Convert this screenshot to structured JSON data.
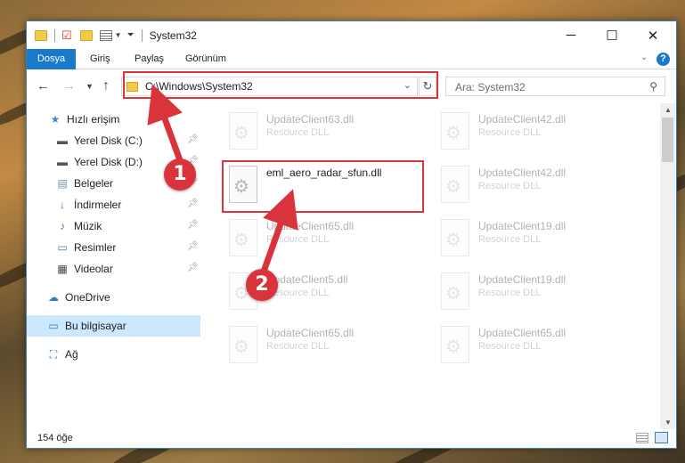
{
  "window": {
    "title": "System32"
  },
  "ribbon": {
    "tabs": [
      "Dosya",
      "Giriş",
      "Paylaş",
      "Görünüm"
    ]
  },
  "address": {
    "path": "C:\\Windows\\System32"
  },
  "search": {
    "placeholder": "Ara: System32"
  },
  "sidebar": {
    "items": [
      {
        "label": "Hızlı erişim",
        "icon": "star-icon"
      },
      {
        "label": "Yerel Disk (C:)",
        "icon": "drive-icon",
        "pinned": true
      },
      {
        "label": "Yerel Disk (D:)",
        "icon": "drive-icon",
        "pinned": true
      },
      {
        "label": "Belgeler",
        "icon": "document-icon",
        "pinned": true
      },
      {
        "label": "İndirmeler",
        "icon": "download-icon",
        "pinned": true
      },
      {
        "label": "Müzik",
        "icon": "music-icon",
        "pinned": true
      },
      {
        "label": "Resimler",
        "icon": "pictures-icon",
        "pinned": true
      },
      {
        "label": "Videolar",
        "icon": "video-icon",
        "pinned": true
      },
      {
        "label": "OneDrive",
        "icon": "cloud-icon"
      },
      {
        "label": "Bu bilgisayar",
        "icon": "computer-icon",
        "selected": true
      },
      {
        "label": "Ağ",
        "icon": "network-icon"
      }
    ]
  },
  "files": {
    "left": [
      {
        "name": "UpdateClient63.dll",
        "type": "Resource DLL"
      },
      {
        "name": "eml_aero_radar_sfun.dll",
        "type": ""
      },
      {
        "name": "UpdateClient65.dll",
        "type": "Resource DLL"
      },
      {
        "name": "UpdateClient5.dll",
        "type": "Resource DLL"
      },
      {
        "name": "UpdateClient65.dll",
        "type": "Resource DLL"
      }
    ],
    "right": [
      {
        "name": "UpdateClient42.dll",
        "type": "Resource DLL"
      },
      {
        "name": "UpdateClient42.dll",
        "type": "Resource DLL"
      },
      {
        "name": "UpdateClient19.dll",
        "type": "Resource DLL"
      },
      {
        "name": "UpdateClient19.dll",
        "type": "Resource DLL"
      },
      {
        "name": "UpdateClient65.dll",
        "type": "Resource DLL"
      }
    ]
  },
  "status": {
    "count": "154 öğe"
  },
  "callouts": [
    "1",
    "2"
  ],
  "colors": {
    "accent": "#1979ca",
    "highlight": "#d9343c",
    "selection": "#cce8ff"
  }
}
